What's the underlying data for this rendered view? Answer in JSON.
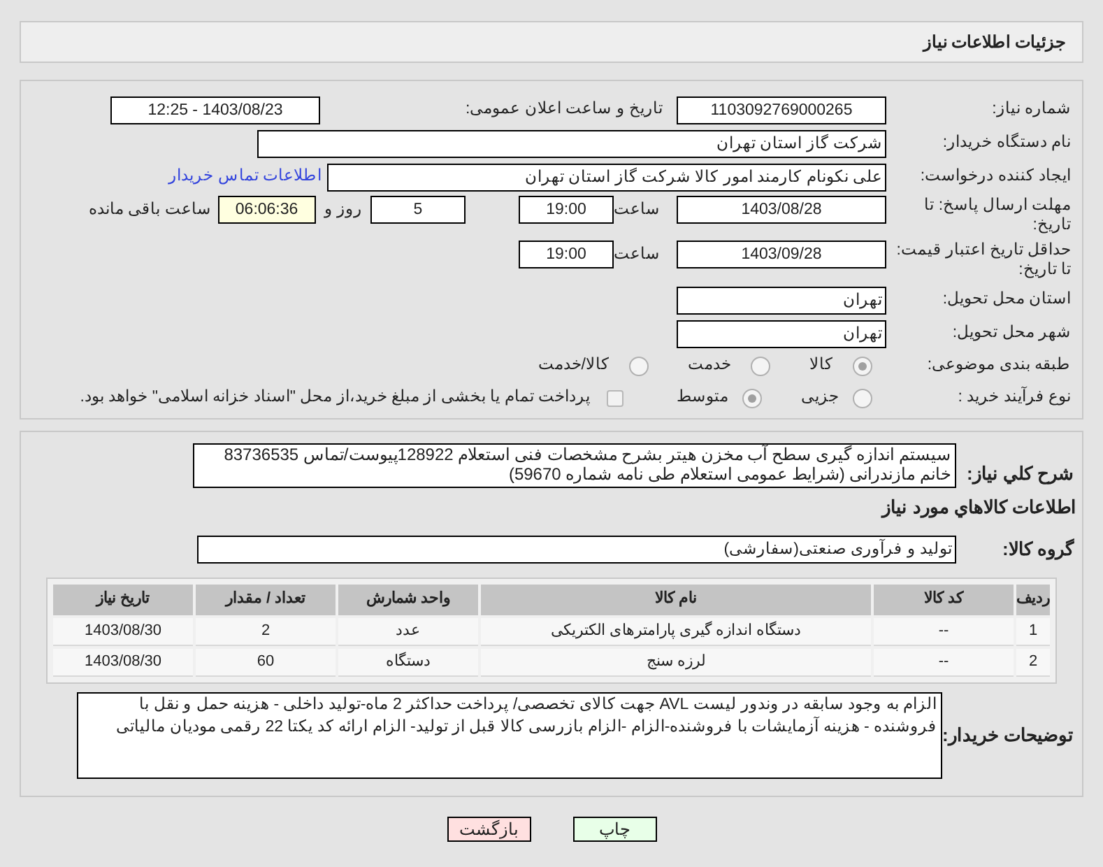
{
  "header": {
    "title": "جزئیات اطلاعات نیاز"
  },
  "need_number": {
    "label": "شماره نیاز:",
    "value": "1103092769000265"
  },
  "announce": {
    "label": "تاریخ و ساعت اعلان عمومی:",
    "value": "1403/08/23 - 12:25"
  },
  "buyer": {
    "label": "نام دستگاه خریدار:",
    "value": "شرکت گاز استان تهران"
  },
  "creator": {
    "label": "ایجاد کننده درخواست:",
    "value": "علی نکونام کارمند امور کالا شرکت گاز استان تهران",
    "link": "اطلاعات تماس خریدار"
  },
  "deadline": {
    "label": "مهلت ارسال پاسخ: تا تاریخ:",
    "date": "1403/08/28",
    "time_label": "ساعت",
    "time": "19:00",
    "days": "5",
    "days_label": "روز و",
    "remaining": "06:06:36",
    "remaining_label": "ساعت باقی مانده"
  },
  "validity": {
    "label": "حداقل تاریخ اعتبار قیمت: تا تاریخ:",
    "date": "1403/09/28",
    "time_label": "ساعت",
    "time": "19:00"
  },
  "province": {
    "label": "استان محل تحویل:",
    "value": "تهران"
  },
  "city": {
    "label": "شهر محل تحویل:",
    "value": "تهران"
  },
  "category": {
    "label": "طبقه بندی موضوعی:",
    "options": [
      {
        "label": "کالا",
        "selected": true
      },
      {
        "label": "خدمت",
        "selected": false
      },
      {
        "label": "کالا/خدمت",
        "selected": false
      }
    ]
  },
  "purchase_type": {
    "label": "نوع فرآیند خرید :",
    "options": [
      {
        "label": "جزیی",
        "selected": false
      },
      {
        "label": "متوسط",
        "selected": true
      }
    ],
    "payment": {
      "label": "پرداخت تمام یا بخشی از مبلغ خرید،از محل \"اسناد خزانه اسلامی\" خواهد بود.",
      "checked": false
    }
  },
  "description": {
    "label": "شرح کلي نياز:",
    "value": "سیستم اندازه گیری سطح آب مخزن هیتر بشرح مشخصات فنی استعلام 128922پیوست/تماس 83736535 خانم مازندرانی (شرایط عمومی استعلام طی نامه شماره 59670)"
  },
  "goods_heading": "اطلاعات كالاهاي مورد نياز",
  "goods_group": {
    "label": "گروه کالا:",
    "value": "تولید و فرآوری صنعتی(سفارشی)"
  },
  "table": {
    "columns": [
      "ردیف",
      "کد کالا",
      "نام کالا",
      "واحد شمارش",
      "تعداد / مقدار",
      "تاریخ نیاز"
    ],
    "rows": [
      [
        "1",
        "--",
        "دستگاه اندازه گیری پارامترهای الکتریکی",
        "عدد",
        "2",
        "1403/08/30"
      ],
      [
        "2",
        "--",
        "لرزه سنج",
        "دستگاه",
        "60",
        "1403/08/30"
      ]
    ]
  },
  "notes": {
    "label": "توضیحات خریدار:",
    "value": "الزام به وجود سابقه در وندور لیست AVL جهت کالای تخصصی/ پرداخت حداکثر 2 ماه-تولید داخلی - هزینه حمل و نقل با فروشنده - هزینه آزمایشات با فروشنده-الزام  -الزام بازرسی کالا قبل از تولید- الزام ارائه کد یکتا 22 رقمی مودیان مالیاتی"
  },
  "buttons": [
    {
      "label": "چاپ",
      "kind": "print"
    },
    {
      "label": "بازگشت",
      "kind": "back"
    }
  ]
}
